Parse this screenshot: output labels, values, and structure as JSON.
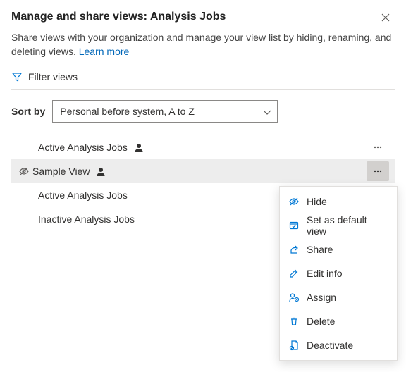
{
  "header": {
    "title": "Manage and share views: Analysis Jobs",
    "description_prefix": "Share views with your organization and manage your view list by hiding, renaming, and deleting views. ",
    "learn_more": "Learn more"
  },
  "filter": {
    "label": "Filter views"
  },
  "sort": {
    "label": "Sort by",
    "selected": "Personal before system, A to Z"
  },
  "views": [
    {
      "name": "Active Analysis Jobs",
      "personal": true,
      "hidden": false,
      "selected": false,
      "show_more": true
    },
    {
      "name": "Sample View",
      "personal": true,
      "hidden": true,
      "selected": true,
      "show_more": true
    },
    {
      "name": "Active Analysis Jobs",
      "personal": false,
      "hidden": false,
      "selected": false,
      "show_more": false
    },
    {
      "name": "Inactive Analysis Jobs",
      "personal": false,
      "hidden": false,
      "selected": false,
      "show_more": false
    }
  ],
  "context_menu": {
    "items": [
      {
        "icon": "eye-off-icon",
        "label": "Hide"
      },
      {
        "icon": "default-icon",
        "label": "Set as default view"
      },
      {
        "icon": "share-icon",
        "label": "Share"
      },
      {
        "icon": "edit-icon",
        "label": "Edit info"
      },
      {
        "icon": "assign-icon",
        "label": "Assign"
      },
      {
        "icon": "delete-icon",
        "label": "Delete"
      },
      {
        "icon": "deactivate-icon",
        "label": "Deactivate"
      }
    ]
  }
}
